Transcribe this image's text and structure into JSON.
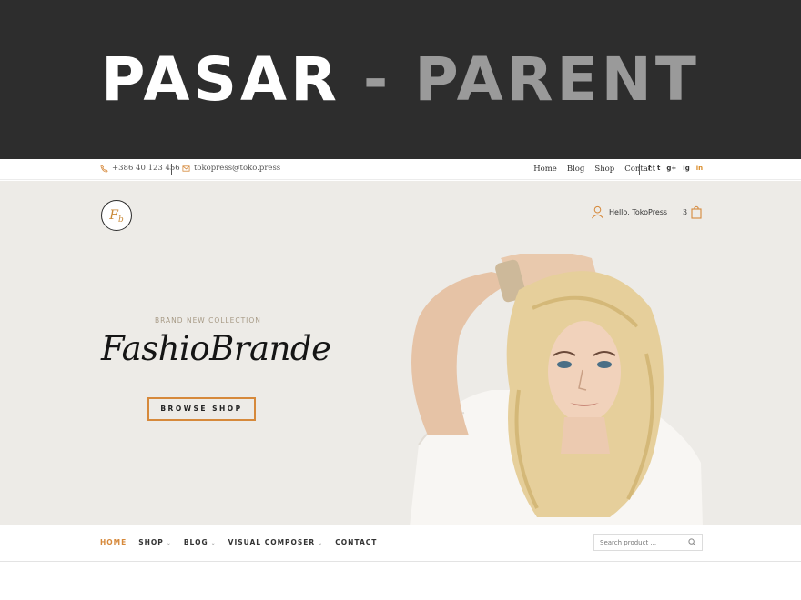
{
  "banner": {
    "title_part1": "PASAR",
    "title_sep": "-",
    "title_part2": "PARENT"
  },
  "topbar": {
    "phone": "+386 40 123 456",
    "email": "tokopress@toko.press",
    "nav": [
      "Home",
      "Blog",
      "Shop",
      "Contact"
    ],
    "social": [
      "f",
      "t",
      "g+",
      "ig",
      "in"
    ]
  },
  "header": {
    "logo_text": "F",
    "logo_sub": "b",
    "account_label": "Hello, TokoPress",
    "cart_count": "3"
  },
  "hero": {
    "tagline": "BRAND NEW COLLECTION",
    "brand": "FashioBrande",
    "cta_label": "BROWSE SHOP"
  },
  "mainnav": {
    "items": [
      "HOME",
      "SHOP",
      "BLOG",
      "VISUAL COMPOSER",
      "CONTACT"
    ],
    "search_placeholder": "Search product ..."
  },
  "colors": {
    "accent": "#d6893b",
    "banner_bg": "#2d2d2d",
    "hero_bg": "#edebe7"
  }
}
